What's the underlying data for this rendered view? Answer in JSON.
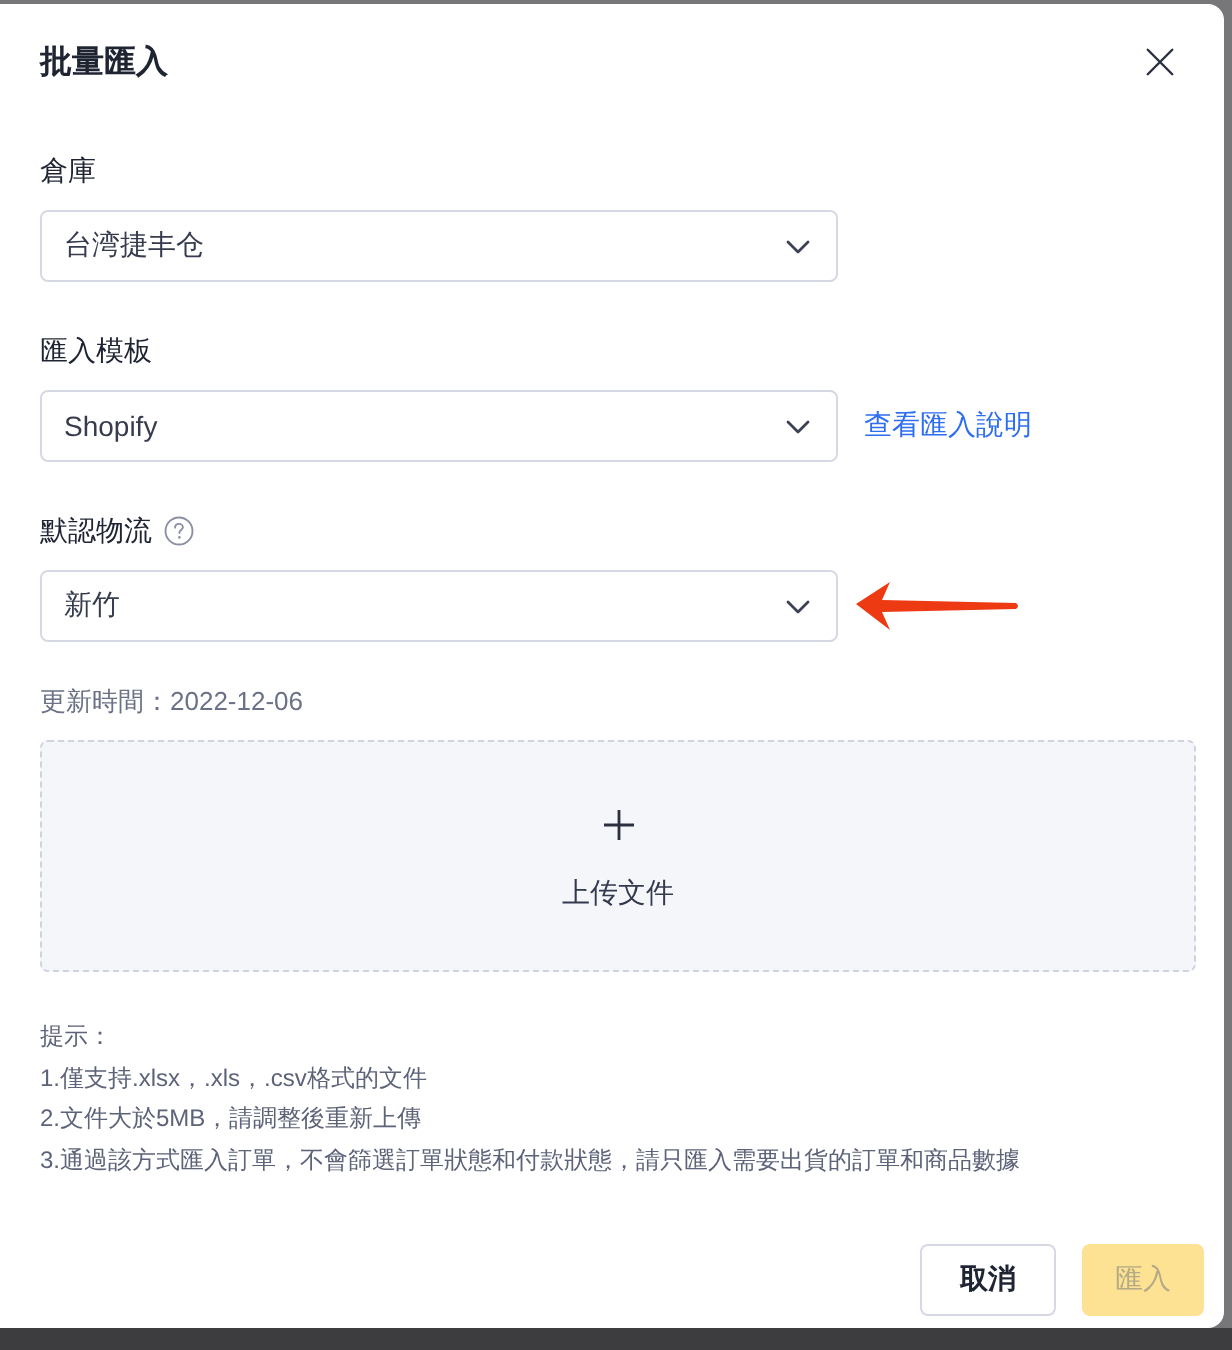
{
  "dialog": {
    "title": "批量匯入"
  },
  "fields": [
    {
      "label": "倉庫",
      "value": "台湾捷丰仓",
      "help": false,
      "marked": false
    },
    {
      "label": "匯入模板",
      "value": "Shopify",
      "link": "查看匯入說明",
      "help": false,
      "marked": false
    },
    {
      "label": "默認物流",
      "value": "新竹",
      "help": true,
      "marked": true
    }
  ],
  "updated": "更新時間：2022-12-06",
  "upload": {
    "label": "上传文件"
  },
  "hints": {
    "title": "提示：",
    "lines": [
      "1.僅支持.xlsx，.xls，.csv格式的文件",
      "2.文件大於5MB，請調整後重新上傳",
      "3.通過該方式匯入訂單，不會篩選訂單狀態和付款狀態，請只匯入需要出貨的訂單和商品數據"
    ]
  },
  "buttons": [
    {
      "label": "取消",
      "kind": "secondary",
      "disabled": false
    },
    {
      "label": "匯入",
      "kind": "primary",
      "disabled": true
    }
  ]
}
